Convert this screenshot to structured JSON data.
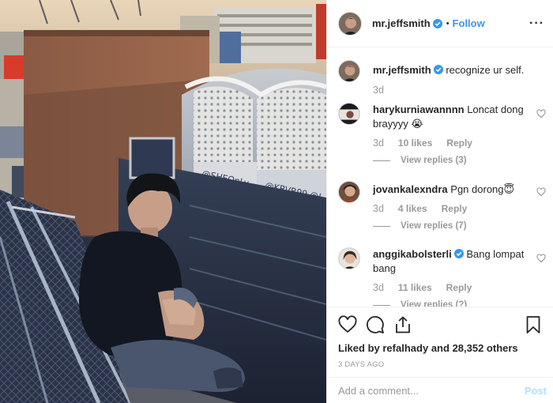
{
  "colors": {
    "link_blue": "#3897f0",
    "post_disabled": "#b2dffc",
    "meta_gray": "#999999",
    "text": "#262626"
  },
  "header": {
    "username": "mr.jeffsmith",
    "separator": "•",
    "follow_label": "Follow",
    "more_icon": "more-horizontal-icon",
    "more_label": "···"
  },
  "caption": {
    "username": "mr.jeffsmith",
    "text": "recognize ur self.",
    "time": "3d"
  },
  "comments": [
    {
      "username": "harykurniawannnn",
      "text": "Loncat dong brayyyy 😭",
      "time": "3d",
      "likes": "10 likes",
      "reply_label": "Reply",
      "view_replies": "View replies (3)"
    },
    {
      "username": "jovankalexndra",
      "text": "Pgn dorong😇",
      "time": "3d",
      "likes": "4 likes",
      "reply_label": "Reply",
      "view_replies": "View replies (7)"
    },
    {
      "username": "anggikabolsterli",
      "text": "Bang lompat bang",
      "time": "3d",
      "likes": "11 likes",
      "reply_label": "Reply",
      "view_replies": "View replies (?)"
    }
  ],
  "actions": {
    "liked_prefix": "Liked by",
    "liked_user": "refalhady",
    "liked_and": "and",
    "liked_others": "28,352 others",
    "date": "3 DAYS AGO"
  },
  "add_comment": {
    "placeholder": "Add a comment...",
    "post_label": "Post"
  }
}
